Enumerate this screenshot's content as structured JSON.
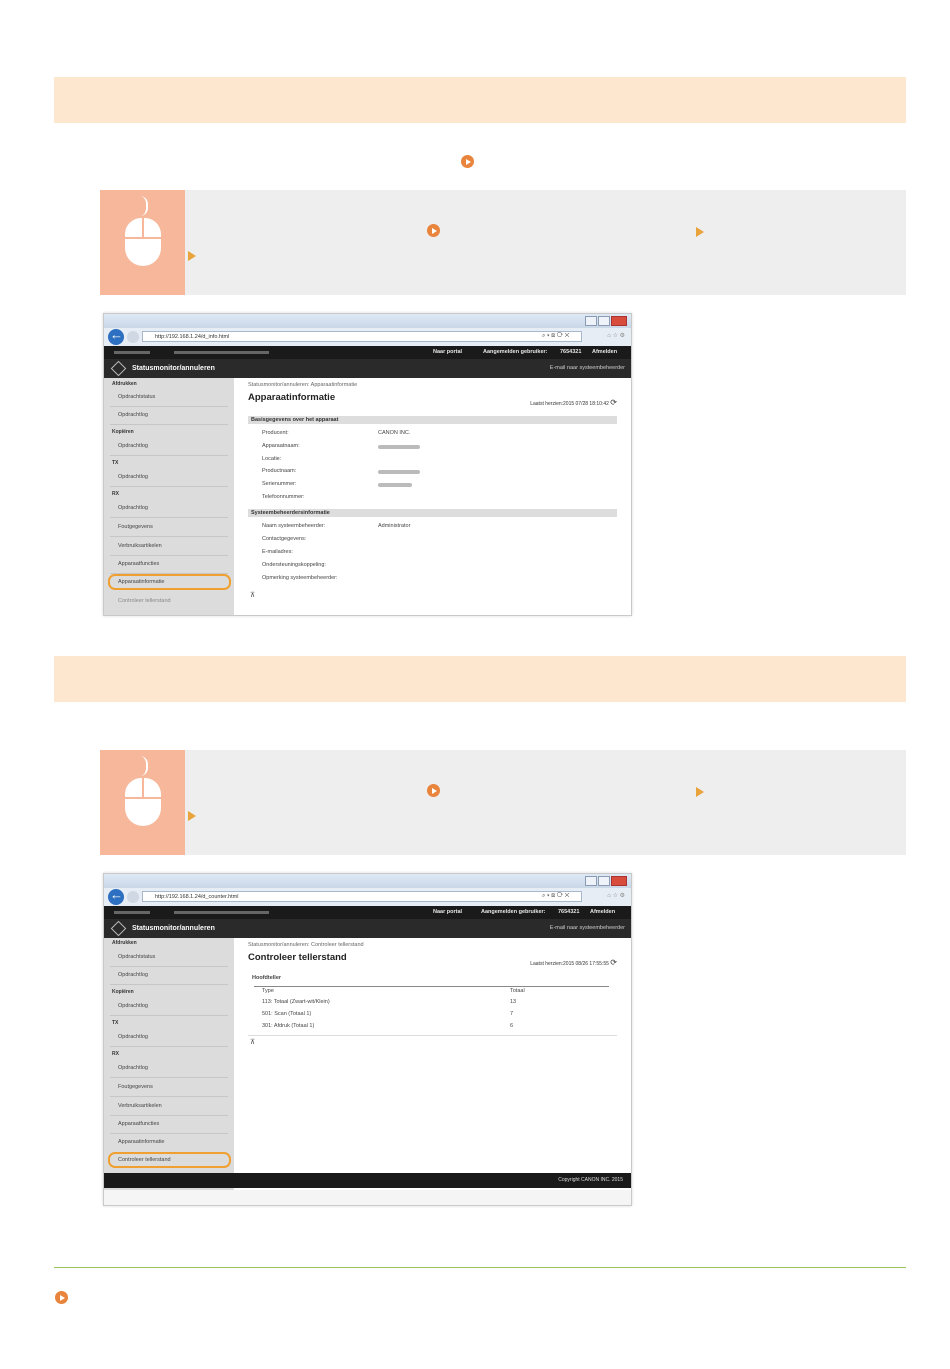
{
  "shot1": {
    "url": "http://192.168.1.24/d_info.html",
    "topnav": {
      "portal": "Naar portal",
      "user_label": "Aangemelden gebruiker:",
      "user": "7654321",
      "logout": "Afmelden"
    },
    "title": "Statusmonitor/annuleren",
    "mail_link": "E-mail naar systeembeheerder",
    "sidebar": {
      "sec1": "Afdrukken",
      "i1": "Opdrachtstatus",
      "i2": "Opdrachtlog",
      "sec2": "Kopiëren",
      "i3": "Opdrachtlog",
      "sec3": "TX",
      "i4": "Opdrachtlog",
      "sec4": "RX",
      "i5": "Opdrachtlog",
      "i6": "Foutgegevens",
      "i7": "Verbruiksartikelen",
      "i8": "Apparaatfuncties",
      "i9": "Apparaatinformatie",
      "i10": "Controleer tellerstand"
    },
    "breadcrumb": "Statusmonitor/annuleren: Apparaatinformatie",
    "heading": "Apparaatinformatie",
    "updated": "Laatst herzien:2015 07/28 18:10:42",
    "section1": "Basisgegevens over het apparaat",
    "rows1": [
      "Producent:",
      "Apparaatnaam:",
      "Locatie:",
      "Productnaam:",
      "Serienummer:",
      "Telefoonnummer:"
    ],
    "manufacturer": "CANON INC.",
    "section2": "Systeembeheerdersinformatie",
    "rows2": [
      "Naam systeembeheerder:",
      "Contactgegevens:",
      "E-mailadres:",
      "Ondersteuningskoppeling:",
      "Opmerking systeembeheerder:"
    ],
    "admin": "Administrator",
    "top_glyph": "⊼"
  },
  "shot2": {
    "url": "http://192.168.1.24/d_counter.html",
    "topnav": {
      "portal": "Naar portal",
      "user_label": "Aangemelden gebruiker:",
      "user": "7654321",
      "logout": "Afmelden"
    },
    "title": "Statusmonitor/annuleren",
    "mail_link": "E-mail naar systeembeheerder",
    "breadcrumb": "Statusmonitor/annuleren: Controleer tellerstand",
    "heading": "Controleer tellerstand",
    "updated": "Laatst herzien:2015 08/26 17:55:55",
    "table_title": "Hoofdteller",
    "col_type": "Type",
    "col_total": "Totaal",
    "rows": [
      {
        "type": "113: Totaal (Zwart-wit/Klein)",
        "total": "13"
      },
      {
        "type": "501: Scan (Totaal 1)",
        "total": "7"
      },
      {
        "type": "301: Afdruk (Totaal 1)",
        "total": "6"
      }
    ],
    "top_glyph": "⊼",
    "copyright": "Copyright CANON INC. 2015"
  },
  "colors": {
    "band": "#fde7cf",
    "accent": "#e8843b",
    "tip_bg": "#eeeeee",
    "tip_icon": "#f6b79a",
    "highlight": "#f0a030",
    "rule": "#9bc25a"
  }
}
